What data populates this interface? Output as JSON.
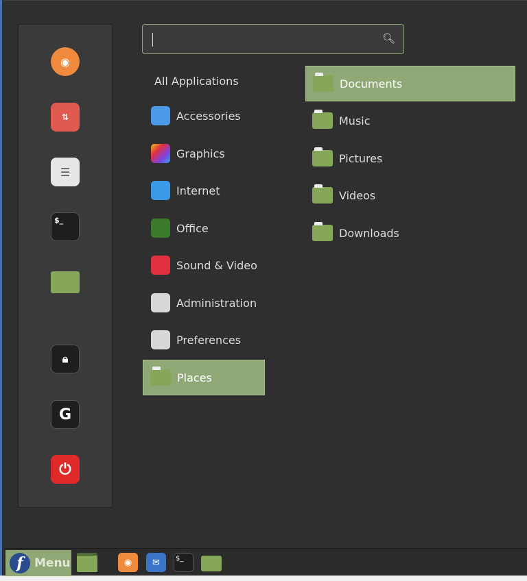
{
  "search": {
    "value": "",
    "icon": "search-icon"
  },
  "favorites": [
    {
      "name": "firefox",
      "icon": "firefox-icon",
      "color": "#f08a3c"
    },
    {
      "name": "software-manager",
      "icon": "software-manager-icon",
      "color": "#e05a50"
    },
    {
      "name": "system-settings",
      "icon": "toggles-icon",
      "color": "#e6e6e6"
    },
    {
      "name": "terminal",
      "icon": "terminal-icon",
      "color": "#1e1e1e"
    },
    {
      "name": "files",
      "icon": "folder-icon",
      "color": "#86a65a"
    },
    {
      "name": "lock-screen",
      "icon": "lock-icon",
      "color": "#1e1e1e"
    },
    {
      "name": "logout",
      "icon": "logout-icon",
      "color": "#1e1e1e"
    },
    {
      "name": "shutdown",
      "icon": "power-icon",
      "color": "#e02a2a"
    }
  ],
  "categories": [
    {
      "label": "All Applications"
    },
    {
      "label": "Accessories",
      "color": "#4a9ae8"
    },
    {
      "label": "Graphics",
      "color": "#c040c0"
    },
    {
      "label": "Internet",
      "color": "#3a9ae8"
    },
    {
      "label": "Office",
      "color": "#3a7a2a"
    },
    {
      "label": "Sound & Video",
      "color": "#e03040"
    },
    {
      "label": "Administration",
      "color": "#d8d8d8"
    },
    {
      "label": "Preferences",
      "color": "#d8d8d8"
    },
    {
      "label": "Places",
      "selected": true
    }
  ],
  "places": [
    {
      "label": "Documents",
      "selected": true
    },
    {
      "label": "Music"
    },
    {
      "label": "Pictures"
    },
    {
      "label": "Videos"
    },
    {
      "label": "Downloads"
    }
  ],
  "taskbar": {
    "menu_label": "Menu",
    "accent": "#8fa876"
  }
}
